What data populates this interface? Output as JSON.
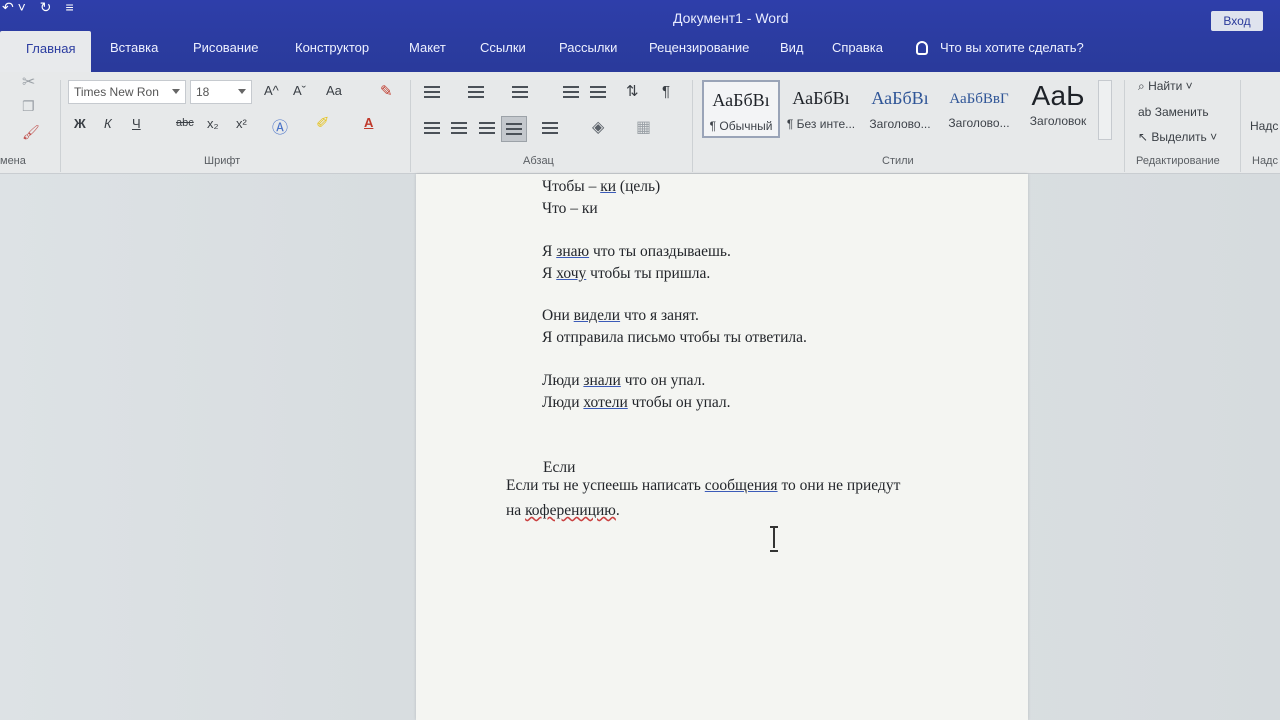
{
  "window": {
    "title": "Документ1 - Word",
    "signin": "Вход"
  },
  "tabs": [
    {
      "label": "Главная"
    },
    {
      "label": "Вставка"
    },
    {
      "label": "Рисование"
    },
    {
      "label": "Конструктор"
    },
    {
      "label": "Макет"
    },
    {
      "label": "Ссылки"
    },
    {
      "label": "Рассылки"
    },
    {
      "label": "Рецензирование"
    },
    {
      "label": "Вид"
    },
    {
      "label": "Справка"
    }
  ],
  "tell_me": "Что вы хотите сделать?",
  "ribbon": {
    "clipboard_label": "мена",
    "font": {
      "name": "Times New Ron",
      "size": "18",
      "label": "Шрифт",
      "case_label": "Aa",
      "bold": "Ж",
      "italic": "К",
      "underline": "Ч",
      "strike": "abc",
      "sub": "x₂",
      "sup": "x²",
      "grow": "A^",
      "shrink": "Aˇ",
      "color_a": "A"
    },
    "paragraph_label": "Абзац",
    "styles_label": "Стили",
    "styles": [
      {
        "sample": "АаБбВı",
        "name": "¶ Обычный"
      },
      {
        "sample": "АаБбВı",
        "name": "¶ Без инте..."
      },
      {
        "sample": "АаБбВı",
        "name": "Заголово..."
      },
      {
        "sample": "АаБбВвГ",
        "name": "Заголово..."
      },
      {
        "sample": "АаЬ",
        "name": "Заголовок"
      }
    ],
    "editing": {
      "find": "Найти",
      "replace": "Заменить",
      "select": "Выделить",
      "label": "Редактирование"
    },
    "extra": {
      "top": "Надс",
      "bottom": "Надс"
    }
  },
  "document": {
    "lines": [
      {
        "parts": [
          {
            "t": "Чтобы – "
          },
          {
            "t": "ки",
            "s": "u"
          },
          {
            "t": " (цель)"
          }
        ]
      },
      {
        "parts": [
          {
            "t": "Что – ки"
          }
        ]
      },
      {
        "parts": [
          {
            "t": "Я "
          },
          {
            "t": "знаю",
            "s": "u"
          },
          {
            "t": " что ты опаздываешь."
          }
        ]
      },
      {
        "parts": [
          {
            "t": "Я "
          },
          {
            "t": "хочу",
            "s": "u"
          },
          {
            "t": " чтобы ты пришла."
          }
        ]
      },
      {
        "parts": [
          {
            "t": "Они "
          },
          {
            "t": "видели",
            "s": "u"
          },
          {
            "t": " что я занят."
          }
        ]
      },
      {
        "parts": [
          {
            "t": "Я отправила письмо чтобы ты ответила."
          }
        ]
      },
      {
        "parts": [
          {
            "t": "Люди "
          },
          {
            "t": "знали",
            "s": "u"
          },
          {
            "t": " что он упал."
          }
        ]
      },
      {
        "parts": [
          {
            "t": "Люди "
          },
          {
            "t": "хотели",
            "s": "u"
          },
          {
            "t": " чтобы он упал."
          }
        ]
      },
      {
        "parts": [
          {
            "t": "Если"
          }
        ]
      },
      {
        "parts": [
          {
            "t": "Если ты не успеешь написать "
          },
          {
            "t": "сообщения",
            "s": "u"
          },
          {
            "t": " то они не приедут"
          }
        ]
      },
      {
        "parts": [
          {
            "t": "на "
          },
          {
            "t": "коференицию",
            "s": "w"
          },
          {
            "t": "."
          }
        ]
      }
    ]
  }
}
